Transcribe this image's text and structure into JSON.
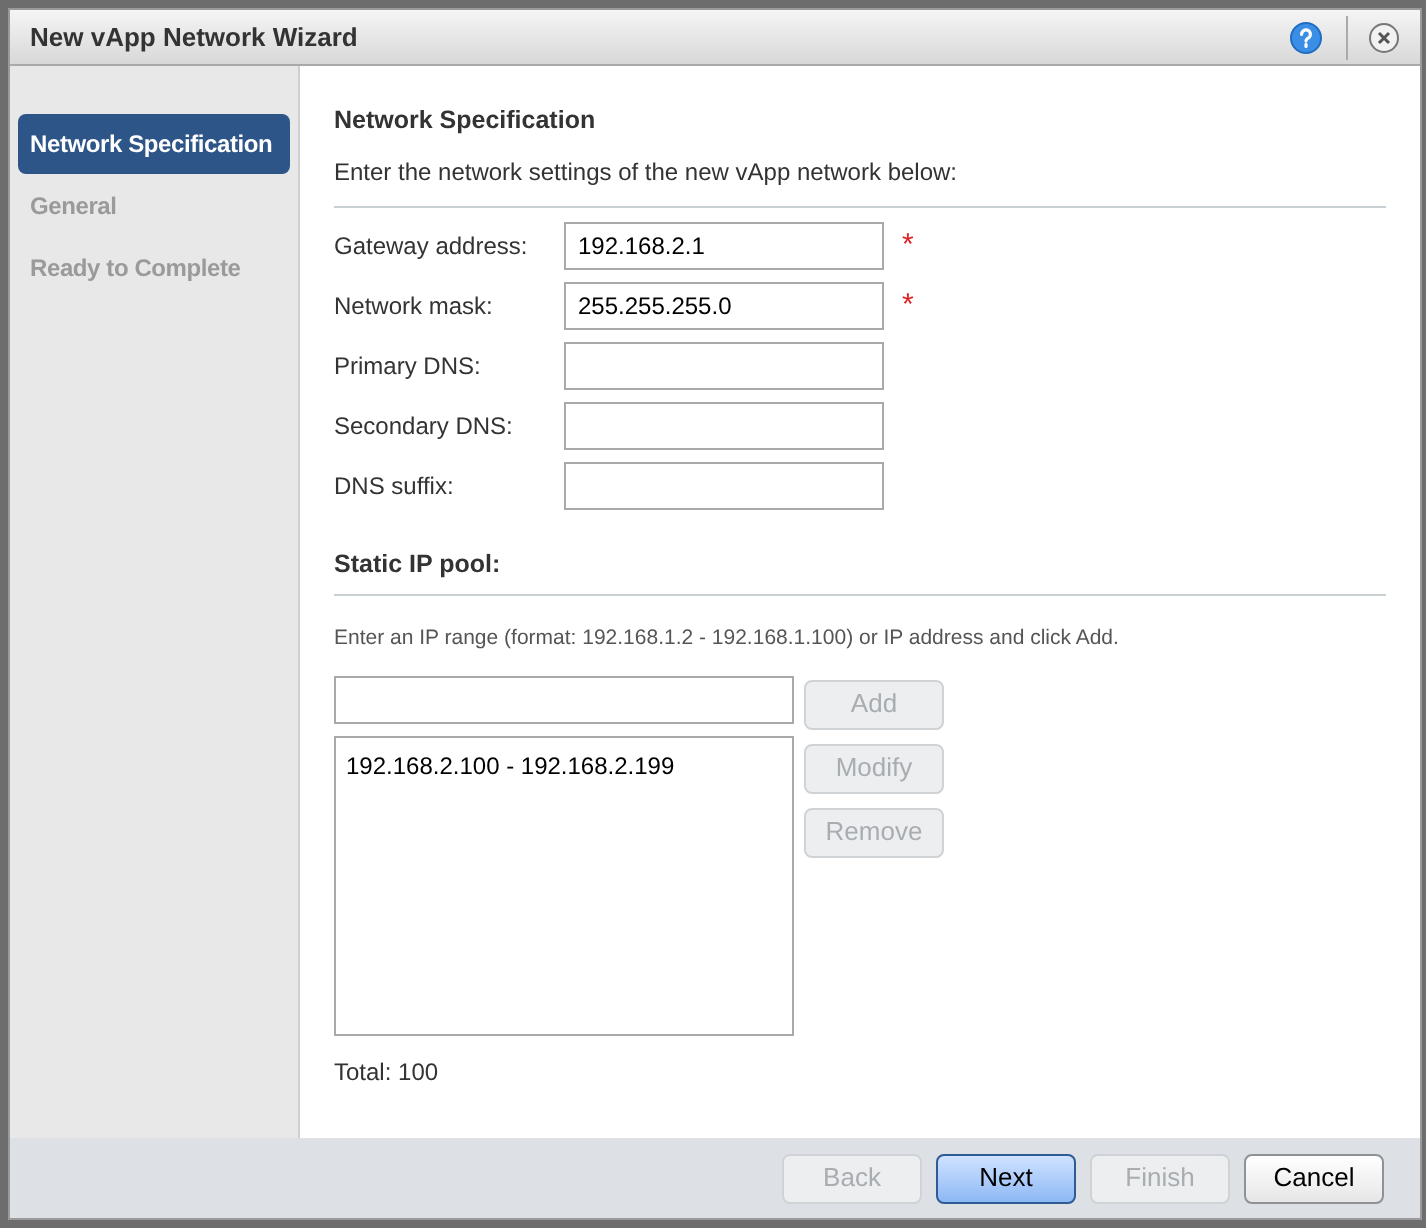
{
  "window": {
    "title": "New vApp Network Wizard"
  },
  "steps": [
    {
      "label": "Network Specification",
      "selected": true,
      "disabled": false
    },
    {
      "label": "General",
      "selected": false,
      "disabled": true
    },
    {
      "label": "Ready to Complete",
      "selected": false,
      "disabled": true
    }
  ],
  "heading": "Network Specification",
  "intro": "Enter the network settings of the new vApp network below:",
  "fields": [
    {
      "label": "Gateway address:",
      "value": "192.168.2.1",
      "required": true
    },
    {
      "label": "Network mask:",
      "value": "255.255.255.0",
      "required": true
    },
    {
      "label": "Primary DNS:",
      "required": false
    },
    {
      "label": "Secondary DNS:",
      "required": false
    },
    {
      "label": "DNS suffix:",
      "required": false
    }
  ],
  "required_mark": "*",
  "pool": {
    "heading": "Static IP pool:",
    "hint": "Enter an IP range (format: 192.168.1.2 - 192.168.1.100) or IP address and click Add.",
    "entries": [
      {
        "text": "192.168.2.100 - 192.168.2.199"
      }
    ],
    "buttons": [
      {
        "label": "Add",
        "disabled": true
      },
      {
        "label": "Modify",
        "disabled": true
      },
      {
        "label": "Remove",
        "disabled": true
      }
    ],
    "total": "Total: 100"
  },
  "footer_buttons": [
    {
      "label": "Back",
      "disabled": true,
      "primary": false
    },
    {
      "label": "Next",
      "disabled": false,
      "primary": true
    },
    {
      "label": "Finish",
      "disabled": true,
      "primary": false
    },
    {
      "label": "Cancel",
      "disabled": false,
      "primary": false
    }
  ]
}
